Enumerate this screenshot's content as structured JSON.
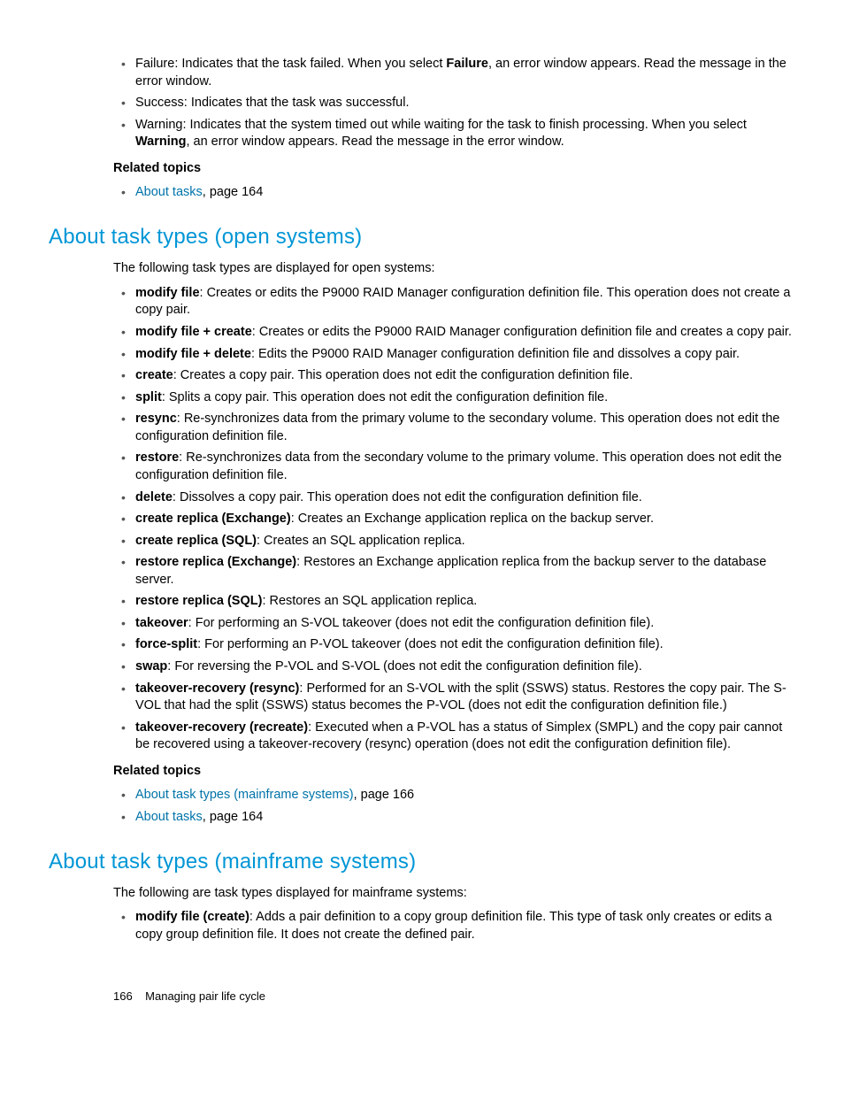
{
  "top": {
    "items": [
      {
        "pre": "Failure: Indicates that the task failed. When you select ",
        "bold": "Failure",
        "post": ", an error window appears. Read the message in the error window."
      },
      {
        "pre": "Success: Indicates that the task was successful.",
        "bold": "",
        "post": ""
      },
      {
        "pre": "Warning: Indicates that the system timed out while waiting for the task to finish processing. When you select ",
        "bold": "Warning",
        "post": ", an error window appears. Read the message in the error window."
      }
    ],
    "related_heading": "Related topics",
    "related": [
      {
        "link": "About tasks",
        "suffix": ", page 164"
      }
    ]
  },
  "open": {
    "heading": "About task types (open systems)",
    "intro": "The following task types are displayed for open systems:",
    "items": [
      {
        "term": "modify file",
        "desc": ": Creates or edits the P9000 RAID Manager configuration definition file. This operation does not create a copy pair."
      },
      {
        "term": "modify file + create",
        "desc": ": Creates or edits the P9000 RAID Manager configuration definition file and creates a copy pair."
      },
      {
        "term": "modify file + delete",
        "desc": ": Edits the P9000 RAID Manager configuration definition file and dissolves a copy pair."
      },
      {
        "term": "create",
        "desc": ": Creates a copy pair. This operation does not edit the configuration definition file."
      },
      {
        "term": "split",
        "desc": ": Splits a copy pair.  This operation does not edit the configuration definition file."
      },
      {
        "term": "resync",
        "desc": ": Re-synchronizes data from the primary volume to the secondary volume.  This operation does not edit the configuration definition file."
      },
      {
        "term": "restore",
        "desc": ": Re-synchronizes data from the secondary volume to the primary volume.  This operation does not edit the configuration definition file."
      },
      {
        "term": "delete",
        "desc": ": Dissolves a copy pair. This operation does not edit the configuration definition file."
      },
      {
        "term": "create replica (Exchange)",
        "desc": ": Creates an Exchange application replica on the backup server."
      },
      {
        "term": "create replica (SQL)",
        "desc": ": Creates an SQL application replica."
      },
      {
        "term": "restore replica (Exchange)",
        "desc": ": Restores an Exchange application replica from the backup server to the database server."
      },
      {
        "term": "restore replica (SQL)",
        "desc": ": Restores an SQL application replica."
      },
      {
        "term": "takeover",
        "desc": ": For performing an S-VOL takeover (does not edit the configuration definition file)."
      },
      {
        "term": "force-split",
        "desc": ": For performing an P-VOL takeover (does not edit the configuration definition file)."
      },
      {
        "term": "swap",
        "desc": ": For reversing the P-VOL and S-VOL (does not edit the configuration definition file)."
      },
      {
        "term": "takeover-recovery (resync)",
        "desc": ": Performed for an S-VOL with the split (SSWS) status. Restores the copy pair. The S-VOL that had the split (SSWS) status becomes the P-VOL (does not edit the configuration definition file.)"
      },
      {
        "term": "takeover-recovery (recreate)",
        "desc": ": Executed when a P-VOL has a status of Simplex (SMPL) and the copy pair cannot be recovered using a takeover-recovery (resync) operation (does not edit the configuration definition file)."
      }
    ],
    "related_heading": "Related topics",
    "related": [
      {
        "link": "About task types (mainframe systems)",
        "suffix": ", page 166"
      },
      {
        "link": "About tasks",
        "suffix": ", page 164"
      }
    ]
  },
  "mainframe": {
    "heading": "About task types (mainframe systems)",
    "intro": "The following are task types displayed for mainframe systems:",
    "items": [
      {
        "term": "modify file (create)",
        "desc": ": Adds a pair definition to a copy group definition file. This type of task only creates or edits a copy group definition file. It does not create the defined pair."
      }
    ]
  },
  "footer": {
    "page_no": "166",
    "title": "Managing pair life cycle"
  }
}
